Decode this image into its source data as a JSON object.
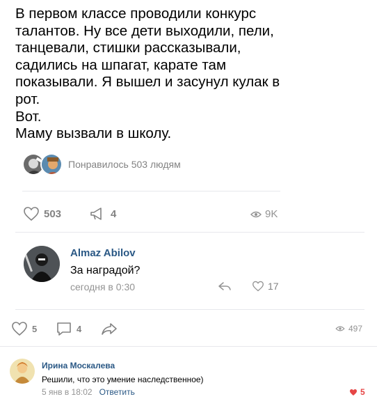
{
  "post": {
    "text": "В первом классе проводили конкурс\nталантов. Ну все дети выходили, пели,\nтанцевали, стишки рассказывали,\nсадились на шпагат, карате там\nпоказывали. Я вышел и засунул кулак в\nрот.\nВот.\nМаму вызвали в школу.",
    "liked_by_text": "Понравилось 503 людям",
    "likes": "503",
    "shares": "4",
    "views": "9K"
  },
  "comment1": {
    "author": "Almaz Abilov",
    "text": "За наградой?",
    "date": "сегодня в 0:30",
    "likes": "17"
  },
  "repost_actions": {
    "likes": "5",
    "comments": "4",
    "views": "497"
  },
  "comment2": {
    "author": "Ирина Москалева",
    "text": "Решили, что это умение наследственное)",
    "date": "5 янв в 18:02",
    "reply_label": "Ответить",
    "likes": "5"
  },
  "colors": {
    "link": "#2a5885",
    "muted": "#828282",
    "heart_active": "#e64646",
    "divider": "#e7e8ec"
  }
}
